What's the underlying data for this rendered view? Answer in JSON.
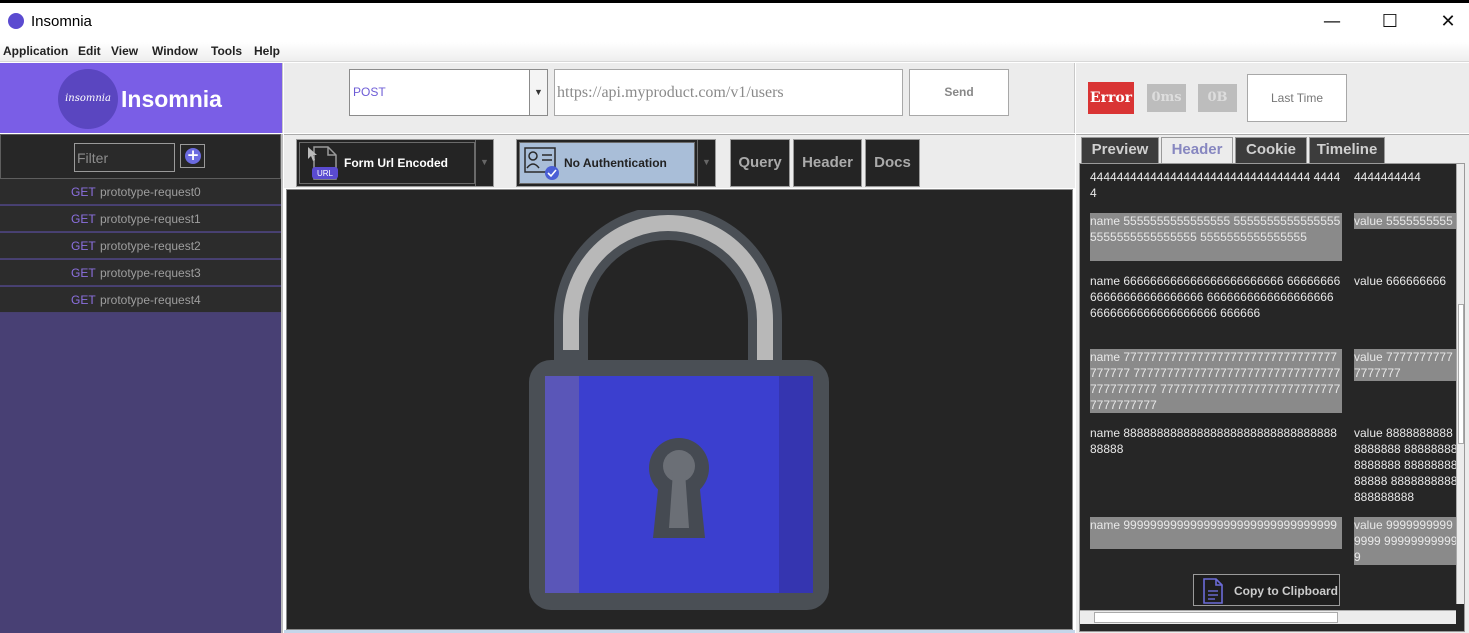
{
  "window": {
    "title": "Insomnia",
    "minimize_glyph": "—",
    "maximize_glyph": "☐",
    "close_glyph": "✕"
  },
  "menubar": {
    "items": [
      "Application",
      "Edit",
      "View",
      "Window",
      "Tools",
      "Help"
    ]
  },
  "brand": {
    "logo_text": "insomnia",
    "name": "Insomnia",
    "color": "#7a5ee6"
  },
  "request": {
    "method": "POST",
    "url_placeholder": "https://api.myproduct.com/v1/users",
    "send_label": "Send"
  },
  "response": {
    "error_label": "Error",
    "time_label": "0ms",
    "size_label": "0B",
    "last_time_label": "Last Time"
  },
  "sidebar": {
    "filter_placeholder": "Filter",
    "add_glyph": "+",
    "requests": [
      {
        "verb": "GET",
        "name": "prototype-request0"
      },
      {
        "verb": "GET",
        "name": "prototype-request1"
      },
      {
        "verb": "GET",
        "name": "prototype-request2"
      },
      {
        "verb": "GET",
        "name": "prototype-request3"
      },
      {
        "verb": "GET",
        "name": "prototype-request4"
      }
    ]
  },
  "middle": {
    "body_type_label": "Form Url Encoded",
    "body_icon_text": "URL",
    "auth_type_label": "No Authentication",
    "tabs": [
      "Query",
      "Header",
      "Docs"
    ]
  },
  "right": {
    "tabs": [
      "Preview",
      "Header",
      "Cookie",
      "Timeline"
    ],
    "active_tab": "Header",
    "headers": [
      {
        "name": "444444444444444444444444444444444 44444",
        "value": "4444444444"
      },
      {
        "name": "name 5555555555555555 5555555555555555 5555555555555555 5555555555555555",
        "value": "value 5555555555"
      },
      {
        "name": "name 666666666666666666666666 6666666666666666666666666 6666666666666666666 6666666666666666666 666666",
        "value": "value 666666666"
      },
      {
        "name": "name 77777777777777777777777777777777777777 77777777777777777777777777777777777777777 7777777777777777777777777777777777777",
        "value": "value 77777777777777777"
      },
      {
        "name": "name 8888888888888888888888888888888888888",
        "value": "value 88888888888888888 888888888888888 8888888888888 8888888888888888888"
      },
      {
        "name": "name 99999999999999999999999999999999",
        "value": "value 99999999999999 999999999999"
      }
    ],
    "copy_label": "Copy to Clipboard"
  }
}
